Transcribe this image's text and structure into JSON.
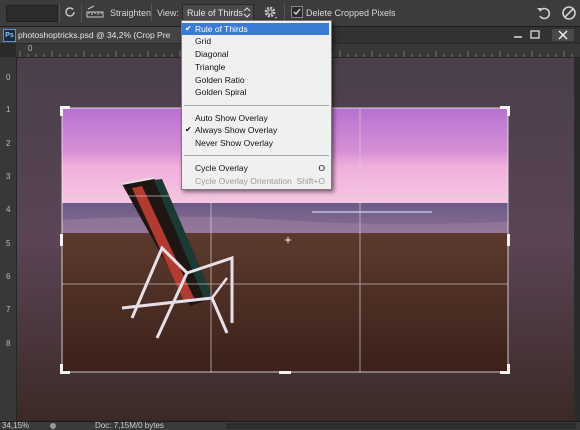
{
  "options_bar": {
    "straighten_label": "Straighten",
    "view_label": "View:",
    "view_value": "Rule of Thirds",
    "delete_cropped_label": "Delete Cropped Pixels",
    "delete_cropped_checked": true
  },
  "document": {
    "title": "photoshoptricks.psd @ 34,2% (Crop Pre",
    "app_badge": "Ps"
  },
  "rulers": {
    "top": [
      "0"
    ],
    "left": [
      "0",
      "1",
      "2",
      "3",
      "4",
      "5",
      "6",
      "7",
      "8"
    ]
  },
  "menu": {
    "items": [
      {
        "label": "Rule of Thirds",
        "checked": true,
        "selected": true
      },
      {
        "label": "Grid"
      },
      {
        "label": "Diagonal"
      },
      {
        "label": "Triangle"
      },
      {
        "label": "Golden Ratio"
      },
      {
        "label": "Golden Spiral"
      },
      {
        "label": "Auto Show Overlay"
      },
      {
        "label": "Always Show Overlay",
        "checked": true
      },
      {
        "label": "Never Show Overlay"
      },
      {
        "label": "Cycle Overlay",
        "shortcut": "O"
      },
      {
        "label": "Cycle Overlay Orientation",
        "shortcut": "Shift+O",
        "disabled": true
      }
    ],
    "check_glyph": "✔"
  },
  "status": {
    "zoom": "34,15%",
    "doc_size": "Doc: 7,15M/0 bytes"
  },
  "colors": {
    "accent": "#3a7bd5",
    "sky_top": "#c17bd4",
    "sky_horizon": "#e8a6d8",
    "sand": "#4a2a1e"
  }
}
